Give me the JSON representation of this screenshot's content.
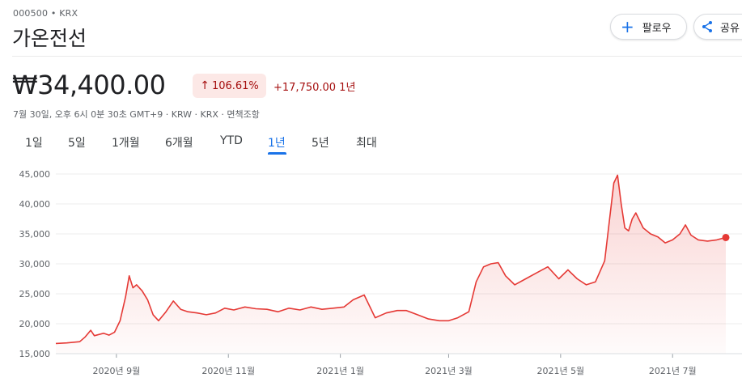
{
  "header": {
    "ticker": "000500 • KRX",
    "company": "가온전선",
    "follow_label": "팔로우",
    "share_label": "공유"
  },
  "quote": {
    "price": "₩34,400.00",
    "change_percent": "106.61%",
    "change_abs": "+17,750.00 1년",
    "meta": "7월 30일, 오후 6시 0분 30초 GMT+9 · KRW · KRX · 면책조항"
  },
  "tabs": [
    "1일",
    "5일",
    "1개월",
    "6개월",
    "YTD",
    "1년",
    "5년",
    "최대"
  ],
  "active_tab": "1년",
  "colors": {
    "accent": "#1a73e8",
    "negative_bg": "#fce8e6",
    "line": "#e53935",
    "down_text": "#a50e0e"
  },
  "chart_data": {
    "type": "area",
    "title": "",
    "xlabel": "",
    "ylabel": "",
    "ylim": [
      15000,
      45000
    ],
    "y_ticks": [
      15000,
      20000,
      25000,
      30000,
      35000,
      40000,
      45000
    ],
    "y_tick_labels": [
      "15,000",
      "20,000",
      "25,000",
      "30,000",
      "35,000",
      "40,000",
      "45,000"
    ],
    "x_tick_labels": [
      "2020년 9월",
      "2020년 11월",
      "2021년 1월",
      "2021년 3월",
      "2021년 5월",
      "2021년 7월"
    ],
    "x_tick_dates": [
      "2020-09-01",
      "2020-11-01",
      "2021-01-01",
      "2021-03-01",
      "2021-05-01",
      "2021-07-01"
    ],
    "x_range": [
      "2020-07-30",
      "2021-07-30"
    ],
    "grid": true,
    "series": [
      {
        "x": [
          "2020-07-30",
          "2020-08-05",
          "2020-08-12",
          "2020-08-15",
          "2020-08-18",
          "2020-08-20",
          "2020-08-25",
          "2020-08-28",
          "2020-08-31",
          "2020-09-03",
          "2020-09-06",
          "2020-09-08",
          "2020-09-10",
          "2020-09-12",
          "2020-09-15",
          "2020-09-18",
          "2020-09-21",
          "2020-09-24",
          "2020-09-28",
          "2020-10-02",
          "2020-10-06",
          "2020-10-10",
          "2020-10-15",
          "2020-10-20",
          "2020-10-25",
          "2020-10-30",
          "2020-11-04",
          "2020-11-10",
          "2020-11-16",
          "2020-11-22",
          "2020-11-28",
          "2020-12-04",
          "2020-12-10",
          "2020-12-16",
          "2020-12-22",
          "2020-12-28",
          "2021-01-03",
          "2021-01-08",
          "2021-01-14",
          "2021-01-20",
          "2021-01-26",
          "2021-02-01",
          "2021-02-06",
          "2021-02-12",
          "2021-02-18",
          "2021-02-24",
          "2021-03-01",
          "2021-03-06",
          "2021-03-12",
          "2021-03-16",
          "2021-03-20",
          "2021-03-24",
          "2021-03-28",
          "2021-04-01",
          "2021-04-06",
          "2021-04-12",
          "2021-04-18",
          "2021-04-24",
          "2021-04-30",
          "2021-05-05",
          "2021-05-10",
          "2021-05-15",
          "2021-05-20",
          "2021-05-25",
          "2021-05-30",
          "2021-06-01",
          "2021-06-03",
          "2021-06-05",
          "2021-06-07",
          "2021-06-09",
          "2021-06-11",
          "2021-06-15",
          "2021-06-19",
          "2021-06-23",
          "2021-06-27",
          "2021-07-01",
          "2021-07-05",
          "2021-07-08",
          "2021-07-11",
          "2021-07-15",
          "2021-07-20",
          "2021-07-25",
          "2021-07-30"
        ],
        "values": [
          16700,
          16800,
          17000,
          17800,
          18900,
          18000,
          18400,
          18100,
          18600,
          20500,
          24500,
          28000,
          26000,
          26500,
          25500,
          24000,
          21500,
          20500,
          22000,
          23800,
          22400,
          22000,
          21800,
          21500,
          21800,
          22600,
          22300,
          22800,
          22500,
          22400,
          22000,
          22600,
          22300,
          22800,
          22400,
          22600,
          22800,
          24000,
          24800,
          21000,
          21800,
          22200,
          22200,
          21500,
          20800,
          20500,
          20500,
          21000,
          22000,
          27000,
          29500,
          30000,
          30200,
          28000,
          26500,
          27500,
          28500,
          29500,
          27500,
          29000,
          27500,
          26500,
          27000,
          30500,
          43500,
          44800,
          40000,
          36000,
          35500,
          37500,
          38500,
          36000,
          35000,
          34500,
          33500,
          34000,
          35000,
          36500,
          34800,
          34000,
          33800,
          34000,
          34400
        ]
      }
    ]
  }
}
